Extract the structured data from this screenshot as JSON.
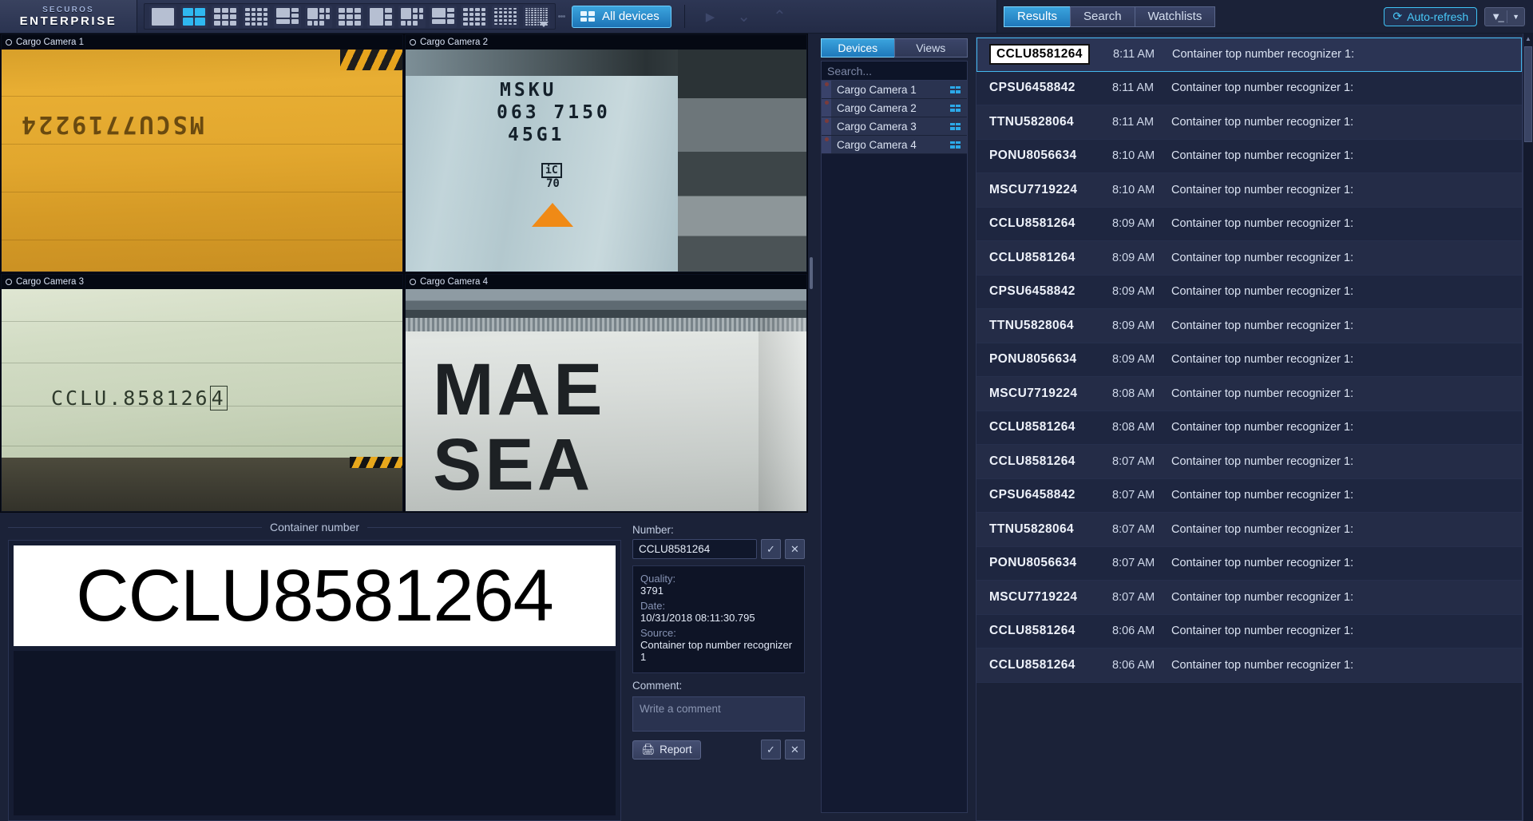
{
  "app": {
    "logo_top": "SECUROS",
    "logo_bottom": "ENTERPRISE"
  },
  "toolbar": {
    "all_devices_label": "All devices",
    "layout_buttons": [
      {
        "name": "layout-1",
        "cells": 1,
        "active": false
      },
      {
        "name": "layout-4",
        "cells": 4,
        "active": true
      },
      {
        "name": "layout-9",
        "cells": 9,
        "active": false
      },
      {
        "name": "layout-16",
        "cells": 16,
        "active": false
      },
      {
        "name": "layout-1plus5",
        "cells": 6,
        "active": false
      },
      {
        "name": "layout-1plus7",
        "cells": 8,
        "active": false
      },
      {
        "name": "layout-1plus12",
        "cells": 13,
        "active": false
      },
      {
        "name": "layout-1plus3-side",
        "cells": 4,
        "active": false
      },
      {
        "name": "layout-2plus8",
        "cells": 10,
        "active": false
      },
      {
        "name": "layout-3plus9",
        "cells": 12,
        "active": false
      },
      {
        "name": "layout-20",
        "cells": 20,
        "active": false
      },
      {
        "name": "layout-25",
        "cells": 25,
        "active": false
      },
      {
        "name": "layout-more",
        "cells": 64,
        "active": false
      }
    ],
    "nav_icons": [
      "play-icon",
      "chevron-down-icon",
      "chevron-up-icon"
    ]
  },
  "results_header": {
    "tabs": [
      {
        "label": "Results",
        "active": true
      },
      {
        "label": "Search",
        "active": false
      },
      {
        "label": "Watchlists",
        "active": false
      }
    ],
    "auto_refresh_label": "Auto-refresh",
    "auto_refresh_icon": "refresh-icon",
    "filter_icon": "filter-icon",
    "filter_dropdown_icon": "chevron-down-icon"
  },
  "video": {
    "cells": [
      {
        "label": "Cargo Camera 1",
        "record_icon": "record-circle-icon",
        "container_text": "MSCU7719224"
      },
      {
        "label": "Cargo Camera 2",
        "record_icon": "record-circle-icon",
        "line1": "MSKU",
        "line2": "063 7150",
        "line3": "45G1",
        "mark_ic": "iC",
        "mark_70": "70"
      },
      {
        "label": "Cargo Camera 3",
        "record_icon": "record-circle-icon",
        "container_prefix": "CCLU.858126",
        "container_check": "4"
      },
      {
        "label": "Cargo Camera 4",
        "record_icon": "record-circle-icon",
        "line1": "MAE",
        "line2": "SEA"
      }
    ]
  },
  "container_panel": {
    "group_title": "Container number",
    "plate_text": "CCLU8581264"
  },
  "details": {
    "number_label": "Number:",
    "number_value": "CCLU8581264",
    "accept_icon": "check-icon",
    "reject_icon": "close-icon",
    "quality_label": "Quality:",
    "quality_value": "3791",
    "date_label": "Date:",
    "date_value": "10/31/2018 08:11:30.795",
    "source_label": "Source:",
    "source_value": "Container top number recognizer 1",
    "comment_label": "Comment:",
    "comment_placeholder": "Write a comment",
    "report_label": "Report",
    "report_icon": "printer-icon",
    "comment_accept_icon": "check-icon",
    "comment_reject_icon": "close-icon"
  },
  "devices": {
    "tabs": [
      {
        "label": "Devices",
        "active": true
      },
      {
        "label": "Views",
        "active": false
      }
    ],
    "search_placeholder": "Search...",
    "items": [
      {
        "label": "Cargo Camera 1",
        "status_icon": "status-dot-icon",
        "grid_icon": "layout-grid-icon"
      },
      {
        "label": "Cargo Camera 2",
        "status_icon": "status-dot-icon",
        "grid_icon": "layout-grid-icon"
      },
      {
        "label": "Cargo Camera 3",
        "status_icon": "status-dot-icon",
        "grid_icon": "layout-grid-icon"
      },
      {
        "label": "Cargo Camera 4",
        "status_icon": "status-dot-icon",
        "grid_icon": "layout-grid-icon"
      }
    ]
  },
  "results": {
    "rows": [
      {
        "number": "CCLU8581264",
        "time": "8:11 AM",
        "description": "Container top number recognizer 1:",
        "selected": true
      },
      {
        "number": "CPSU6458842",
        "time": "8:11 AM",
        "description": "Container top number recognizer 1:",
        "selected": false
      },
      {
        "number": "TTNU5828064",
        "time": "8:11 AM",
        "description": "Container top number recognizer 1:",
        "selected": false
      },
      {
        "number": "PONU8056634",
        "time": "8:10 AM",
        "description": "Container top number recognizer 1:",
        "selected": false
      },
      {
        "number": "MSCU7719224",
        "time": "8:10 AM",
        "description": "Container top number recognizer 1:",
        "selected": false
      },
      {
        "number": "CCLU8581264",
        "time": "8:09 AM",
        "description": "Container top number recognizer 1:",
        "selected": false
      },
      {
        "number": "CCLU8581264",
        "time": "8:09 AM",
        "description": "Container top number recognizer 1:",
        "selected": false
      },
      {
        "number": "CPSU6458842",
        "time": "8:09 AM",
        "description": "Container top number recognizer 1:",
        "selected": false
      },
      {
        "number": "TTNU5828064",
        "time": "8:09 AM",
        "description": "Container top number recognizer 1:",
        "selected": false
      },
      {
        "number": "PONU8056634",
        "time": "8:09 AM",
        "description": "Container top number recognizer 1:",
        "selected": false
      },
      {
        "number": "MSCU7719224",
        "time": "8:08 AM",
        "description": "Container top number recognizer 1:",
        "selected": false
      },
      {
        "number": "CCLU8581264",
        "time": "8:08 AM",
        "description": "Container top number recognizer 1:",
        "selected": false
      },
      {
        "number": "CCLU8581264",
        "time": "8:07 AM",
        "description": "Container top number recognizer 1:",
        "selected": false
      },
      {
        "number": "CPSU6458842",
        "time": "8:07 AM",
        "description": "Container top number recognizer 1:",
        "selected": false
      },
      {
        "number": "TTNU5828064",
        "time": "8:07 AM",
        "description": "Container top number recognizer 1:",
        "selected": false
      },
      {
        "number": "PONU8056634",
        "time": "8:07 AM",
        "description": "Container top number recognizer 1:",
        "selected": false
      },
      {
        "number": "MSCU7719224",
        "time": "8:07 AM",
        "description": "Container top number recognizer 1:",
        "selected": false
      },
      {
        "number": "CCLU8581264",
        "time": "8:06 AM",
        "description": "Container top number recognizer 1:",
        "selected": false
      },
      {
        "number": "CCLU8581264",
        "time": "8:06 AM",
        "description": "Container top number recognizer 1:",
        "selected": false
      }
    ]
  },
  "colors": {
    "accent": "#2fb8f0",
    "panel_bg": "#1b2238",
    "selection_border": "#43b8ee",
    "status_dot": "#7a3b3b"
  }
}
